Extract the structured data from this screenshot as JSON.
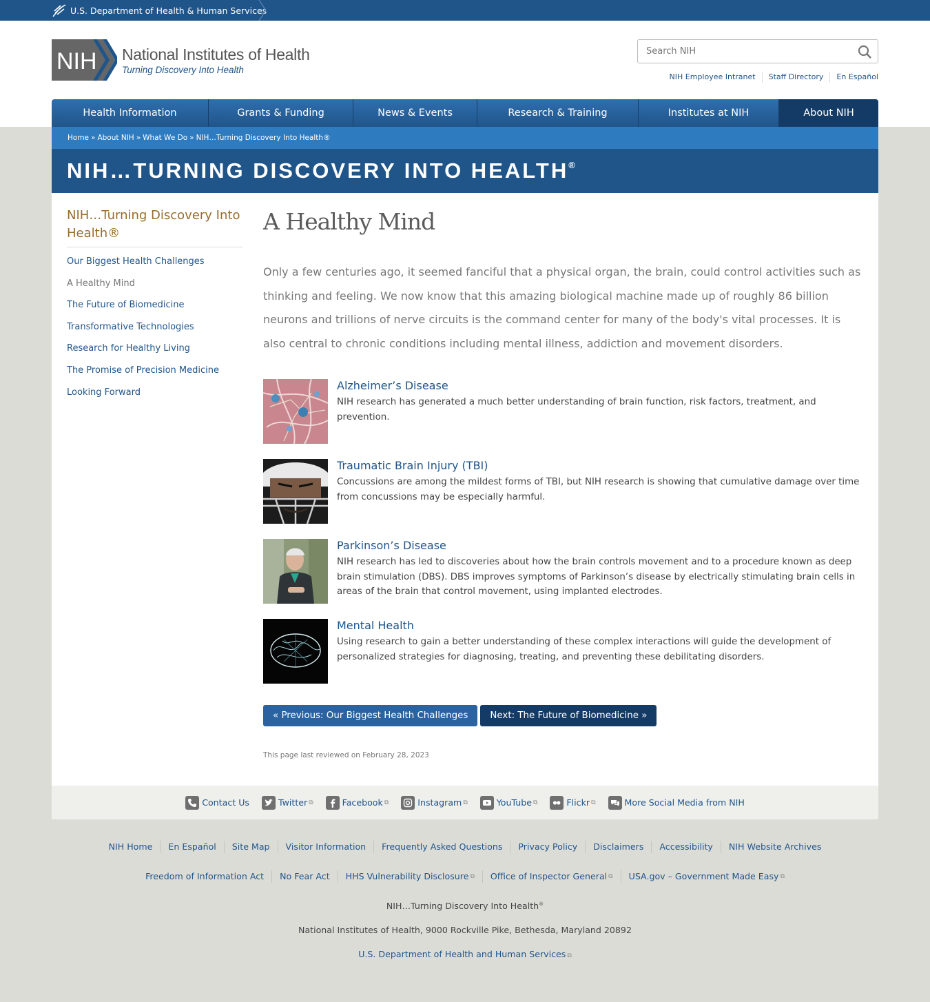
{
  "hhs_bar": {
    "label": "U.S. Department of Health & Human Services"
  },
  "logo": {
    "mark": "NIH",
    "title": "National Institutes of Health",
    "tagline": "Turning Discovery Into Health"
  },
  "search": {
    "placeholder": "Search NIH"
  },
  "utility_links": [
    "NIH Employee Intranet",
    "Staff Directory",
    "En Español"
  ],
  "nav": [
    "Health Information",
    "Grants & Funding",
    "News & Events",
    "Research & Training",
    "Institutes at NIH",
    "About NIH"
  ],
  "breadcrumb": [
    "Home",
    "About NIH",
    "What We Do",
    "NIH…Turning Discovery Into Health®"
  ],
  "banner": {
    "title": "NIH…TURNING DISCOVERY INTO HEALTH",
    "reg": "®"
  },
  "sidebar": {
    "title": "NIH…Turning Discovery Into Health®",
    "items": [
      "Our Biggest Health Challenges",
      "A Healthy Mind",
      "The Future of Biomedicine",
      "Transformative Technologies",
      "Research for Healthy Living",
      "The Promise of Precision Medicine",
      "Looking Forward"
    ]
  },
  "main": {
    "title": "A Healthy Mind",
    "intro": "Only a few centuries ago, it seemed fanciful that a physical organ, the brain, could control activities such as thinking and feeling. We now know that this amazing biological machine made up of roughly 86 billion neurons and trillions of nerve circuits is the command center for many of the body's vital processes.  It is also central to chronic conditions including mental illness, addiction and movement disorders.",
    "topics": [
      {
        "title": "Alzheimer’s Disease",
        "desc": "NIH research has generated a much better understanding of brain function, risk factors, treatment, and prevention."
      },
      {
        "title": "Traumatic Brain Injury (TBI)",
        "desc": "Concussions are among the mildest forms of TBI, but NIH research is showing that cumulative damage over time from concussions may be especially harmful."
      },
      {
        "title": "Parkinson’s Disease",
        "desc": "NIH research has led to discoveries about how the brain controls movement and to a procedure known as deep brain stimulation (DBS). DBS improves symptoms of Parkinson’s disease by electrically stimulating brain cells in areas of the brain that control movement, using implanted electrodes."
      },
      {
        "title": "Mental Health",
        "desc": "Using research to gain a better understanding of these complex interactions will guide the development of personalized strategies for diagnosing, treating, and preventing these debilitating disorders."
      }
    ],
    "prev_label": "« Previous: Our Biggest Health Challenges",
    "next_label": "Next: The Future of Biomedicine »",
    "reviewed": "This page last reviewed on February 28, 2023"
  },
  "social": [
    {
      "label": "Contact Us",
      "icon": "phone-icon"
    },
    {
      "label": "Twitter",
      "icon": "twitter-icon"
    },
    {
      "label": "Facebook",
      "icon": "facebook-icon"
    },
    {
      "label": "Instagram",
      "icon": "instagram-icon"
    },
    {
      "label": "YouTube",
      "icon": "youtube-icon"
    },
    {
      "label": "Flickr",
      "icon": "flickr-icon"
    },
    {
      "label": "More Social Media from NIH",
      "icon": "chat-icon"
    }
  ],
  "footer": {
    "row1": [
      "NIH Home",
      "En Español",
      "Site Map",
      "Visitor Information",
      "Frequently Asked Questions",
      "Privacy Policy",
      "Disclaimers",
      "Accessibility",
      "NIH Website Archives"
    ],
    "row2": [
      "Freedom of Information Act",
      "No Fear Act",
      "HHS Vulnerability Disclosure",
      "Office of Inspector General",
      "USA.gov – Government Made Easy"
    ],
    "name": "NIH…Turning Discovery Into Health",
    "name_reg": "®",
    "address": "National Institutes of Health, 9000 Rockville Pike, Bethesda, Maryland 20892",
    "hhs": "U.S. Department of Health and Human Services"
  },
  "colors": {
    "brand_blue": "#20558a",
    "nav_active": "#143b66",
    "sidebar_title": "#9a6c2b",
    "crumb_blue": "#2f7bbf"
  }
}
